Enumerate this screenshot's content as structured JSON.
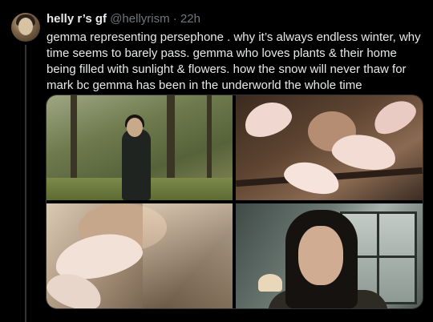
{
  "tweet": {
    "display_name": "helly r’s gf",
    "handle": "@hellyrism",
    "separator": "·",
    "time": "22h",
    "text": "gemma representing persephone .  why it’s always endless winter, why time seems to barely pass. gemma who loves plants & their home being filled with sunlight & flowers. how the snow will never thaw for mark bc gemma has been in the underworld the whole time"
  },
  "colors": {
    "background": "#000000",
    "text_primary": "#e7e9ea",
    "text_secondary": "#71767b",
    "border": "#2f3336"
  }
}
